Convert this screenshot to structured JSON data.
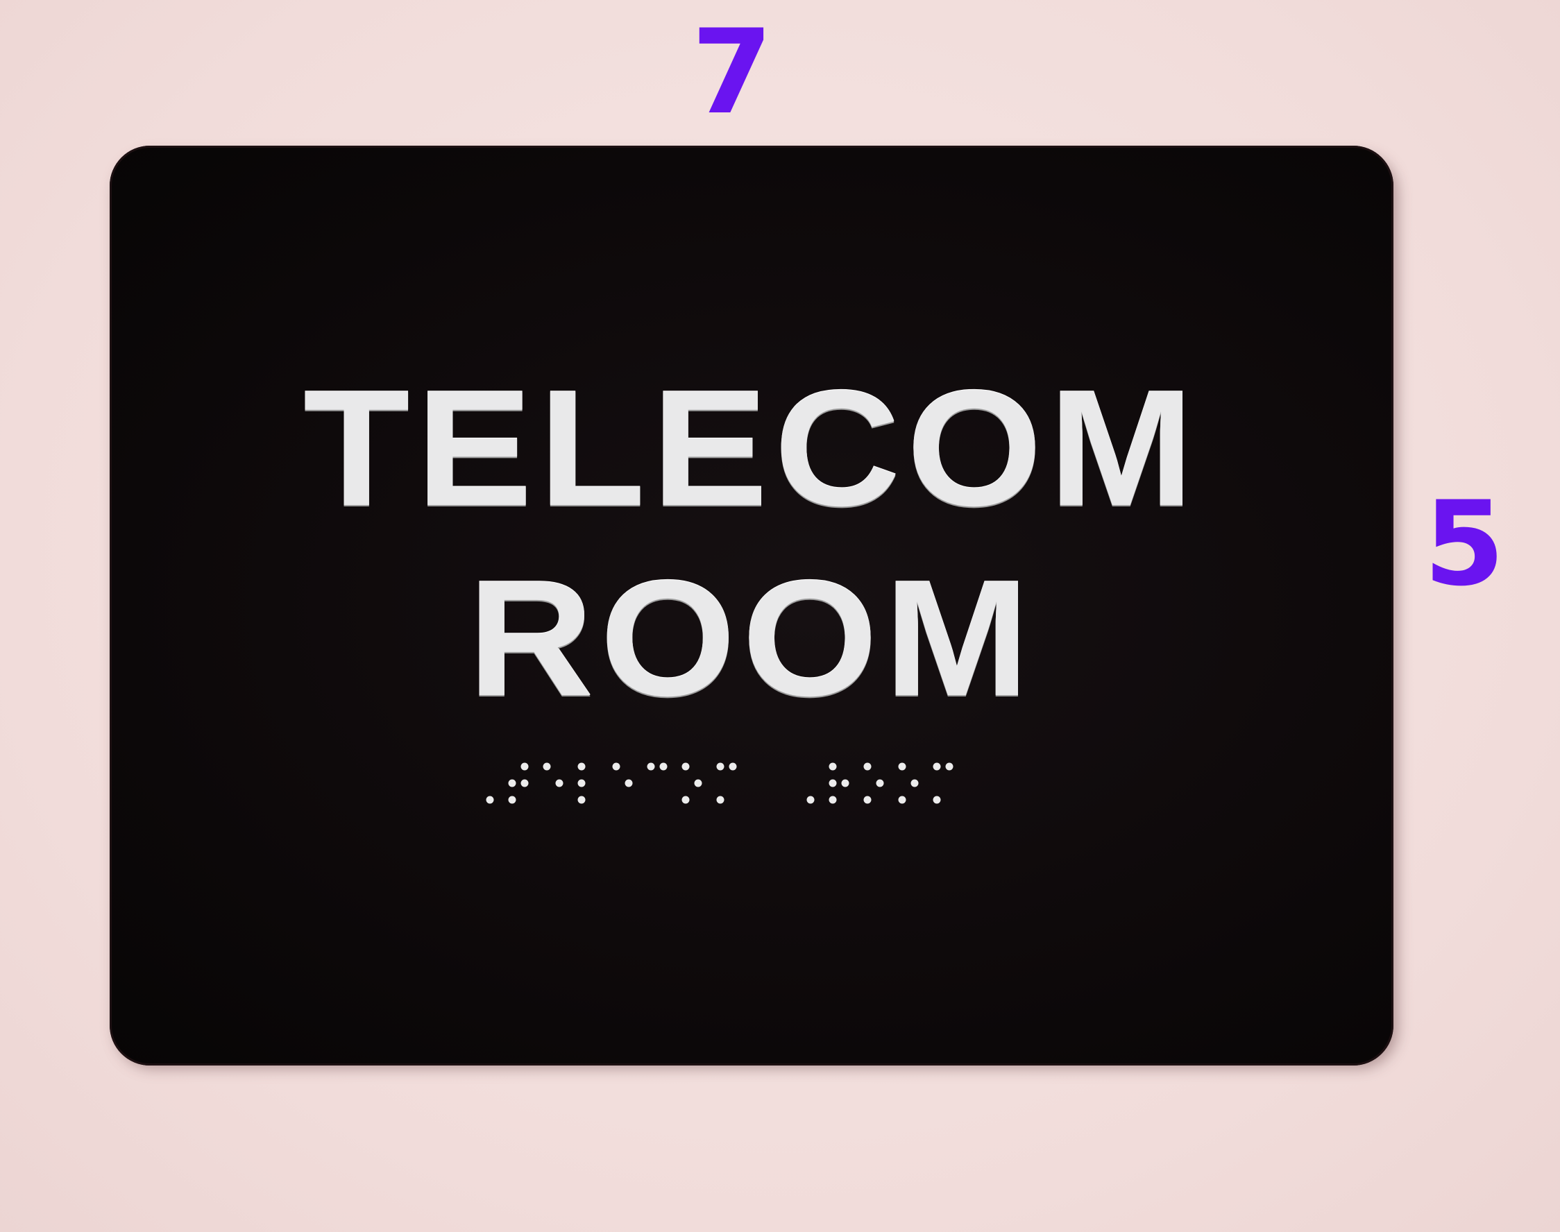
{
  "dimensions": {
    "width_label": "7",
    "height_label": "5",
    "label_color": "#6a14f0"
  },
  "sign": {
    "line_1": "TELECOM",
    "line_2": "ROOM",
    "braille_text": "telecom room",
    "plate_color": "#0c0809",
    "text_color": "#e9e9ea"
  },
  "background_color": "#f3e2e0"
}
